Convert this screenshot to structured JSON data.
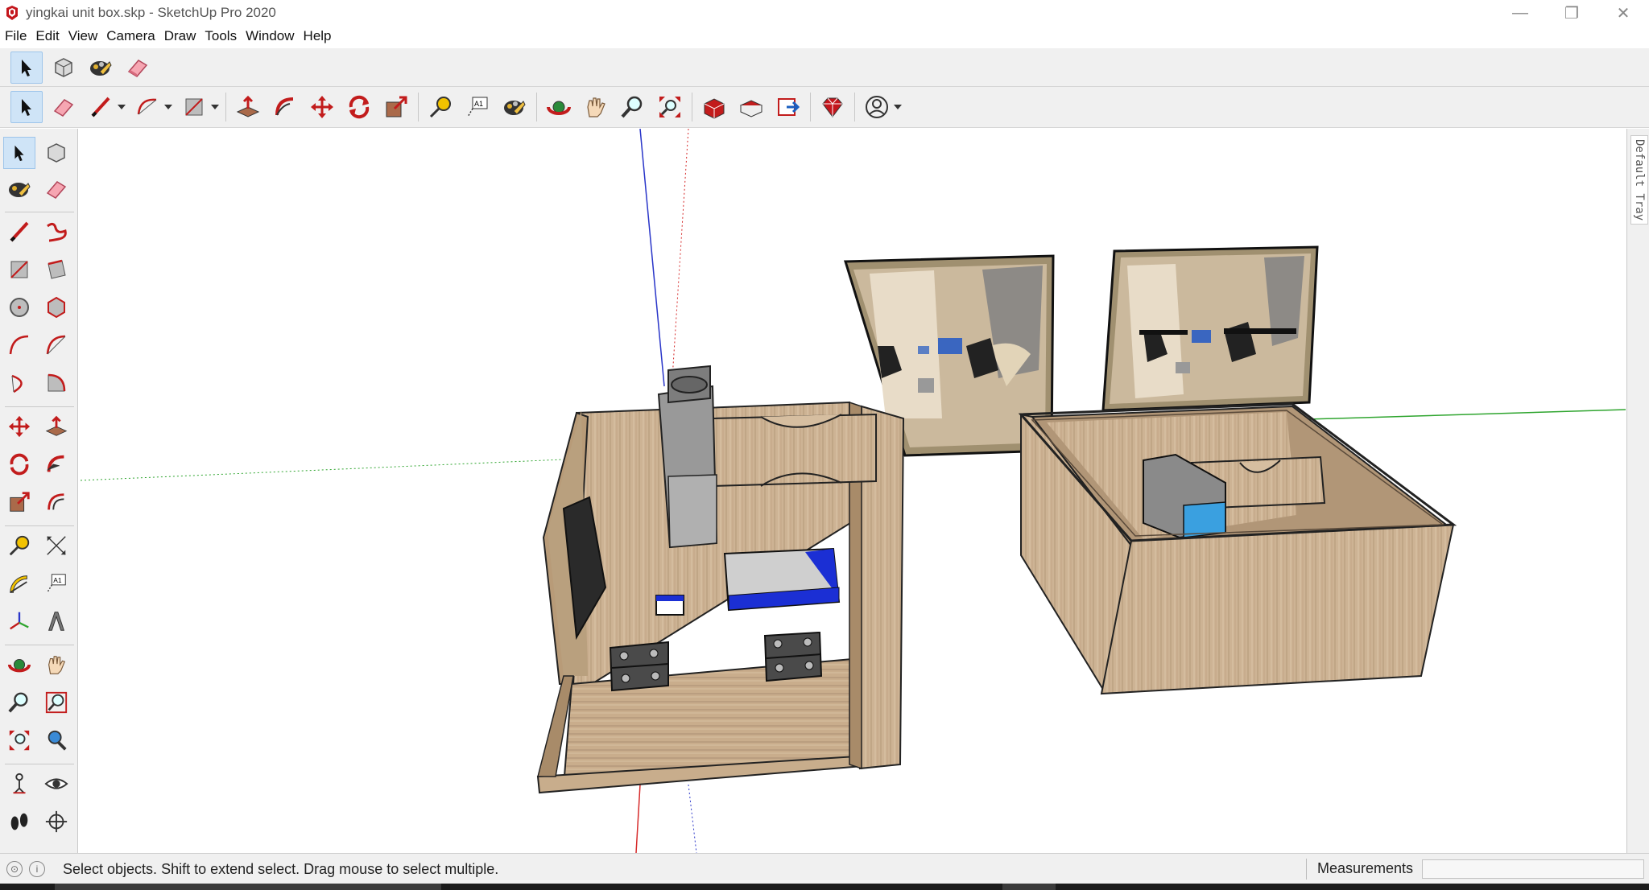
{
  "window": {
    "title": "yingkai unit box.skp - SketchUp Pro 2020",
    "controls": [
      "minimize-icon",
      "restore-icon",
      "close-icon"
    ]
  },
  "menu": [
    "File",
    "Edit",
    "View",
    "Camera",
    "Draw",
    "Tools",
    "Window",
    "Help"
  ],
  "toolbar_top": {
    "tools": [
      "select-icon",
      "component-icon",
      "paint-bucket-icon",
      "eraser-icon"
    ]
  },
  "toolbar_main": {
    "tools": [
      "select-icon",
      "eraser-icon",
      "line-icon",
      "arc-icon",
      "rectangle-icon",
      "push-pull-icon",
      "follow-me-icon",
      "move-icon",
      "rotate-icon",
      "scale-icon",
      "tape-measure-icon",
      "text-icon",
      "paint-bucket-icon",
      "orbit-icon",
      "pan-icon",
      "zoom-icon",
      "zoom-extents-icon",
      "3d-warehouse-icon",
      "extension-warehouse-icon",
      "layout-icon",
      "ruby-icon",
      "account-icon"
    ]
  },
  "left_toolbar": {
    "tools": [
      "select-icon",
      "component-icon",
      "paint-bucket-icon",
      "eraser-icon",
      "line-icon",
      "freehand-icon",
      "rectangle-icon",
      "rotated-rectangle-icon",
      "circle-icon",
      "polygon-icon",
      "arc-icon",
      "two-point-arc-icon",
      "three-point-arc-icon",
      "pie-icon",
      "move-icon",
      "push-pull-icon",
      "rotate-icon",
      "follow-me-icon",
      "scale-icon",
      "offset-icon",
      "tape-measure-icon",
      "dimension-icon",
      "protractor-icon",
      "text-icon",
      "axes-icon",
      "3d-text-icon",
      "orbit-icon",
      "pan-icon",
      "zoom-icon",
      "zoom-window-icon",
      "zoom-extents-icon",
      "previous-view-icon",
      "position-camera-icon",
      "look-around-icon",
      "walk-icon",
      "section-plane-icon"
    ]
  },
  "tray": {
    "label": "Default Tray"
  },
  "status": {
    "message": "Select objects. Shift to extend select. Drag mouse to select multiple.",
    "measurements_label": "Measurements",
    "measurements_value": ""
  },
  "colors": {
    "chrome": "#f0f0f0",
    "active_tool": "#cfe4f7",
    "axis_red": "#d62b2b",
    "axis_green": "#2fa52f",
    "axis_blue": "#2a36c9",
    "wood": "#cdb394",
    "wood_dark": "#9a7e5f"
  }
}
